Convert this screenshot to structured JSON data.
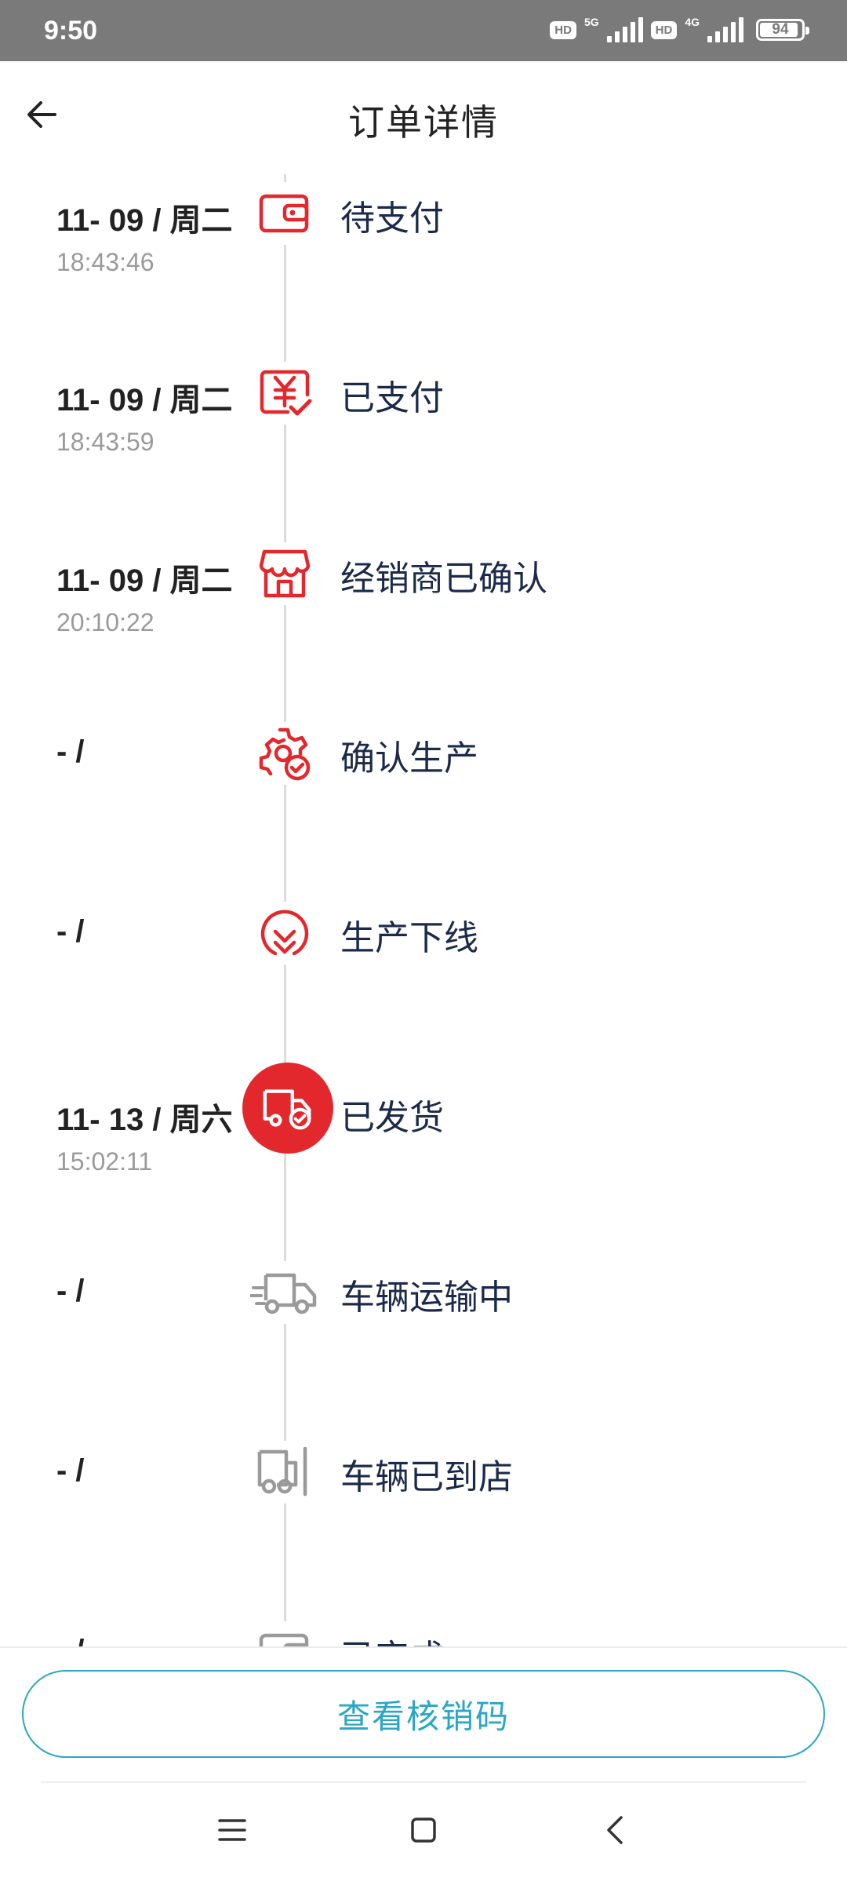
{
  "status_bar": {
    "time": "9:50",
    "hd_badge": "HD",
    "network_1": "5G",
    "network_2": "4G",
    "battery": "94"
  },
  "header": {
    "title": "订单详情",
    "back_icon": "arrow-left-icon"
  },
  "timeline": {
    "line_color": "#dcdcdc",
    "accent_color": "#e3282d",
    "inactive_color": "#9a9a9a",
    "steps": [
      {
        "date": "11- 09 / 周二",
        "time": "18:43:46",
        "label": "待支付",
        "icon": "wallet-icon",
        "state": "done"
      },
      {
        "date": "11- 09 / 周二",
        "time": "18:43:59",
        "label": "已支付",
        "icon": "paid-yen-icon",
        "state": "done"
      },
      {
        "date": "11- 09 / 周二",
        "time": "20:10:22",
        "label": "经销商已确认",
        "icon": "store-icon",
        "state": "done"
      },
      {
        "date": "- /",
        "time": "",
        "label": "确认生产",
        "icon": "gear-check-icon",
        "state": "done"
      },
      {
        "date": "- /",
        "time": "",
        "label": "生产下线",
        "icon": "download-circle-icon",
        "state": "done"
      },
      {
        "date": "11- 13 / 周六",
        "time": "15:02:11",
        "label": "已发货",
        "icon": "truck-check-icon",
        "state": "current"
      },
      {
        "date": "- /",
        "time": "",
        "label": "车辆运输中",
        "icon": "truck-moving-icon",
        "state": "pending"
      },
      {
        "date": "- /",
        "time": "",
        "label": "车辆已到店",
        "icon": "truck-arrived-icon",
        "state": "pending"
      },
      {
        "date": "- /",
        "time": "",
        "label": "已完成",
        "icon": "wallet-icon",
        "state": "pending"
      }
    ]
  },
  "bottom": {
    "button_label": "查看核销码",
    "button_color": "#2aa6c6"
  },
  "nav_bar": {
    "menu_icon": "menu-icon",
    "home_icon": "home-square-icon",
    "back_icon": "back-chevron-icon"
  }
}
